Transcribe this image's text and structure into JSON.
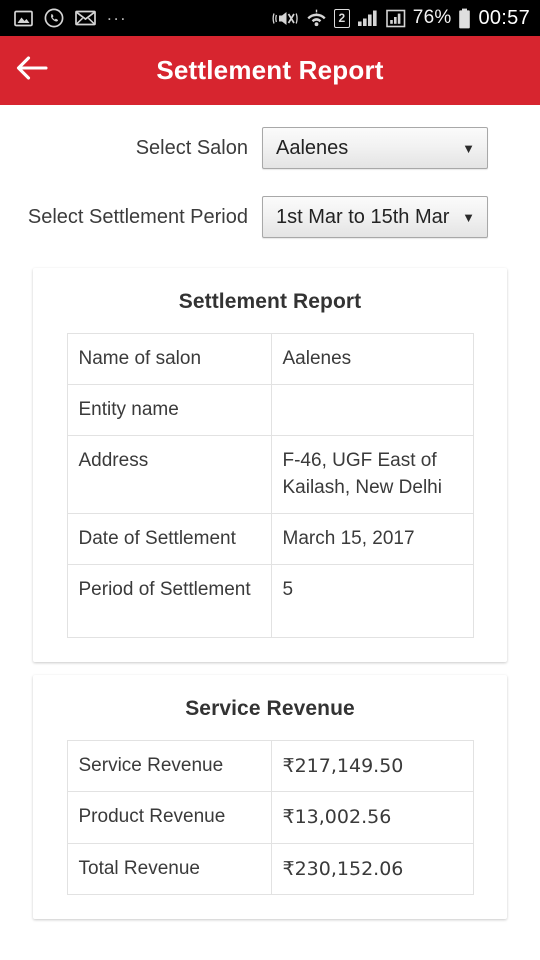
{
  "status_bar": {
    "left_icons": [
      "image-icon",
      "whatsapp-icon",
      "email-icon"
    ],
    "overflow": "...",
    "right_icons": [
      "vibrate-mute-icon",
      "wifi-icon",
      "sim2-icon",
      "signal-icon",
      "signal2-icon",
      "battery-icon"
    ],
    "sim_label": "2",
    "battery_percent": "76%",
    "time": "00:57"
  },
  "app_bar": {
    "back_icon": "back-arrow-icon",
    "title": "Settlement Report",
    "background_color": "#d7252f"
  },
  "form": {
    "salon": {
      "label": "Select Salon",
      "value": "Aalenes",
      "caret": "▼"
    },
    "period": {
      "label": "Select Settlement Period",
      "value": "1st Mar to 15th Mar",
      "caret": "▼"
    }
  },
  "report_card": {
    "title": "Settlement Report",
    "rows": [
      {
        "key": "Name of salon",
        "value": "Aalenes"
      },
      {
        "key": "Entity name",
        "value": ""
      },
      {
        "key": "Address",
        "value": "F-46, UGF East of Kailash, New Delhi"
      },
      {
        "key": "Date of Settlement",
        "value": "March 15, 2017"
      },
      {
        "key": "Period of Settlement",
        "value": "5"
      }
    ]
  },
  "revenue_card": {
    "title": "Service Revenue",
    "rows": [
      {
        "key": "Service Revenue",
        "value": "₹217,149.50"
      },
      {
        "key": "Product Revenue",
        "value": "₹13,002.56"
      },
      {
        "key": "Total Revenue",
        "value": "₹230,152.06"
      }
    ]
  }
}
